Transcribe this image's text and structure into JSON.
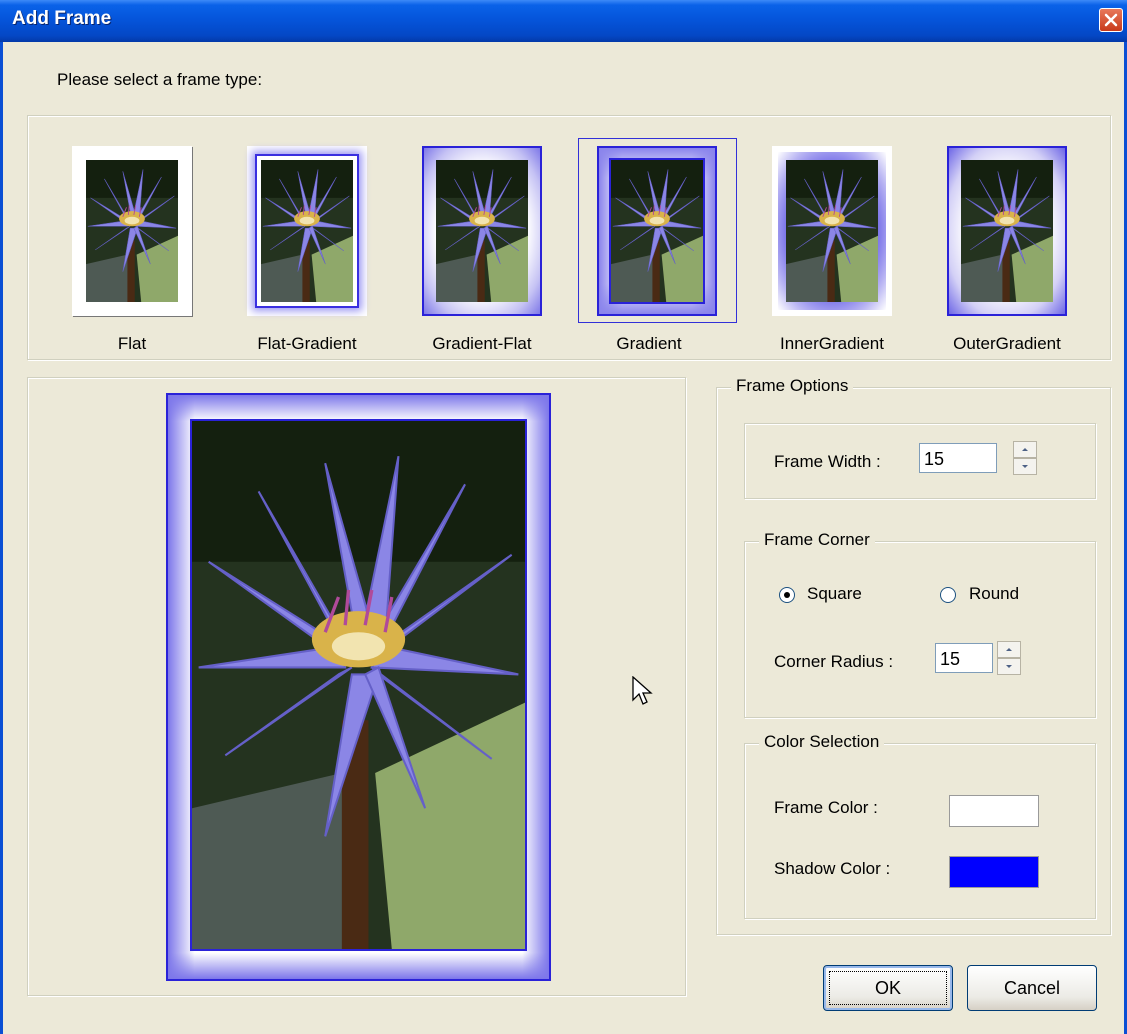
{
  "window": {
    "title": "Add Frame"
  },
  "prompt": "Please select a frame type:",
  "frame_types": [
    {
      "label": "Flat"
    },
    {
      "label": "Flat-Gradient"
    },
    {
      "label": "Gradient-Flat"
    },
    {
      "label": "Gradient",
      "selected": true
    },
    {
      "label": "InnerGradient"
    },
    {
      "label": "OuterGradient"
    }
  ],
  "frame_options": {
    "title": "Frame Options",
    "frame_width_label": "Frame Width :",
    "frame_width_value": "15"
  },
  "frame_corner": {
    "title": "Frame Corner",
    "square_label": "Square",
    "round_label": "Round",
    "selected": "Square",
    "corner_radius_label": "Corner Radius :",
    "corner_radius_value": "15"
  },
  "color_selection": {
    "title": "Color Selection",
    "frame_color_label": "Frame Color :",
    "frame_color": "#FFFFFF",
    "shadow_color_label": "Shadow Color :",
    "shadow_color": "#0000FF"
  },
  "buttons": {
    "ok": "OK",
    "cancel": "Cancel"
  }
}
